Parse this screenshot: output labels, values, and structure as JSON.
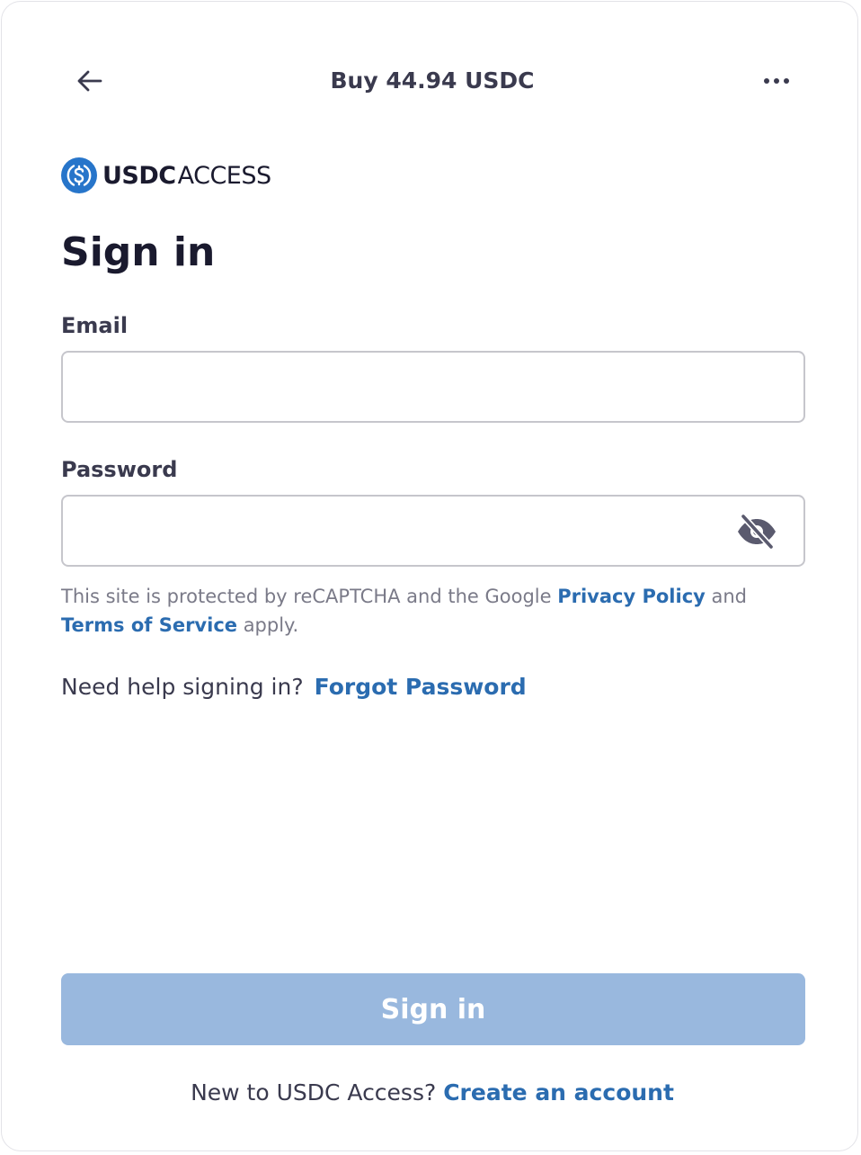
{
  "header": {
    "title": "Buy 44.94 USDC",
    "back_icon": "arrow-left-icon",
    "more_icon": "more-horizontal-icon"
  },
  "logo": {
    "icon": "usdc-coin-icon",
    "text_bold": "USDC",
    "text_light": "ACCESS"
  },
  "form": {
    "title": "Sign in",
    "email_label": "Email",
    "email_value": "",
    "password_label": "Password",
    "password_value": "",
    "visibility_icon": "eye-off-icon"
  },
  "recaptcha": {
    "prefix": "This site is protected by reCAPTCHA and the Google ",
    "privacy_link": "Privacy Policy",
    "middle": " and",
    "terms_link": "Terms of Service",
    "suffix": " apply."
  },
  "help": {
    "text": "Need help signing in?",
    "forgot_link": "Forgot Password"
  },
  "submit": {
    "label": "Sign in",
    "enabled": false
  },
  "footer": {
    "text": "New to USDC Access? ",
    "create_link": "Create an account"
  },
  "colors": {
    "link": "#2b6cb0",
    "button_disabled": "#99b8de",
    "brand_blue": "#2775ca",
    "text_dark": "#1a1a2e"
  }
}
